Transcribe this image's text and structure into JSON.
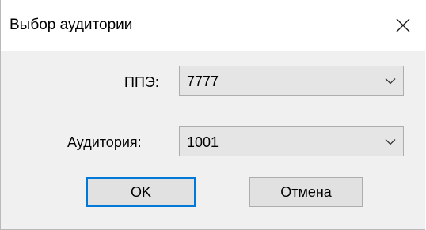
{
  "window": {
    "title": "Выбор аудитории",
    "close_icon": "close-icon"
  },
  "form": {
    "ppe": {
      "label": "ППЭ:",
      "value": "7777",
      "icon": "chevron-down-icon"
    },
    "room": {
      "label": "Аудитория:",
      "value": "1001",
      "icon": "chevron-down-icon"
    }
  },
  "buttons": {
    "ok_label": "OK",
    "cancel_label": "Отмена"
  },
  "colors": {
    "accent": "#0078d7",
    "surface": "#f0f0f0",
    "control_face": "#e1e1e1"
  }
}
